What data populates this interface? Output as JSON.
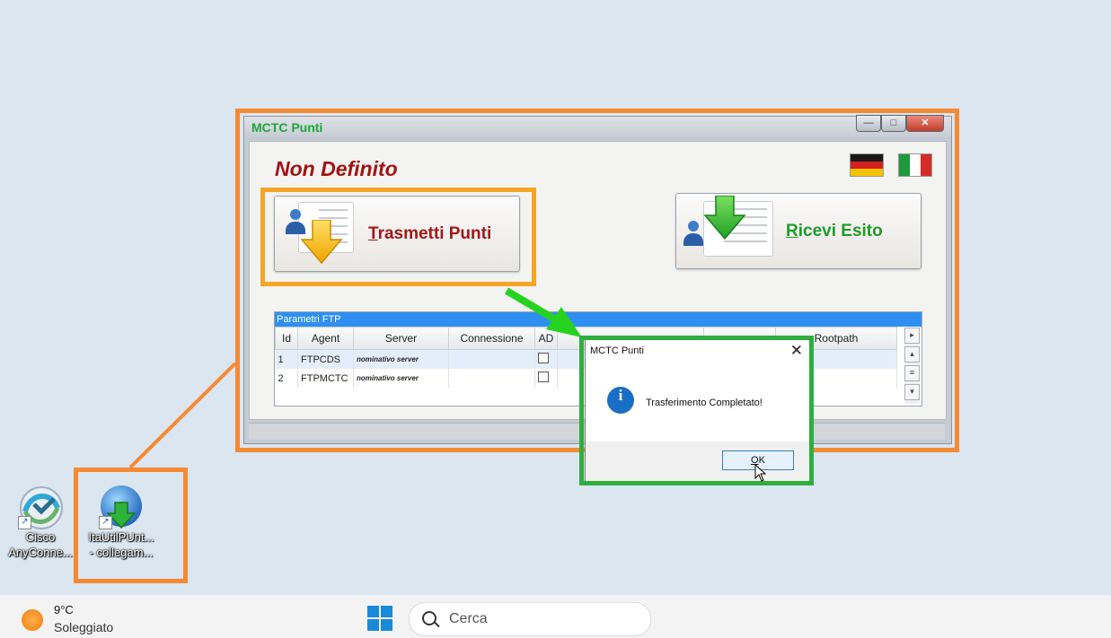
{
  "window": {
    "title": "MCTC Punti",
    "min_glyph": "—",
    "max_glyph": "□",
    "close_glyph": "✕",
    "heading": "Non Definito",
    "flags": [
      "german-flag",
      "italian-flag"
    ],
    "send_button": {
      "accel": "T",
      "rest": "rasmetti Punti"
    },
    "receive_button": {
      "accel": "R",
      "rest": "icevi Esito"
    }
  },
  "ftp": {
    "caption": "Parametri FTP",
    "columns": [
      "Id",
      "Agent",
      "Server",
      "Connessione",
      "AD",
      "",
      "",
      "Rootpath"
    ],
    "rows": [
      {
        "id": "1",
        "agent": "FTPCDS",
        "server": "nominativo server"
      },
      {
        "id": "2",
        "agent": "FTPMCTC",
        "server": "nominativo server"
      }
    ]
  },
  "dialog": {
    "title": "MCTC Punti",
    "close_glyph": "✕",
    "message": "Trasferimento Completato!",
    "info_glyph": "i",
    "ok": {
      "accel": "O",
      "rest": "K"
    }
  },
  "desktop": {
    "icons": [
      {
        "line1": "Cisco",
        "line2": "AnyConne..."
      },
      {
        "line1": "ItaUtilPUnt...",
        "line2": "- collegam..."
      }
    ]
  },
  "taskbar": {
    "temperature": "9°C",
    "weather": "Soleggiato",
    "search_placeholder": "Cerca"
  },
  "colors": {
    "highlight_orange": "#f58a33",
    "highlight_amber": "#f5a623",
    "highlight_green": "#2fae3e",
    "title_green": "#1fa43a",
    "heading_red": "#a01313"
  }
}
